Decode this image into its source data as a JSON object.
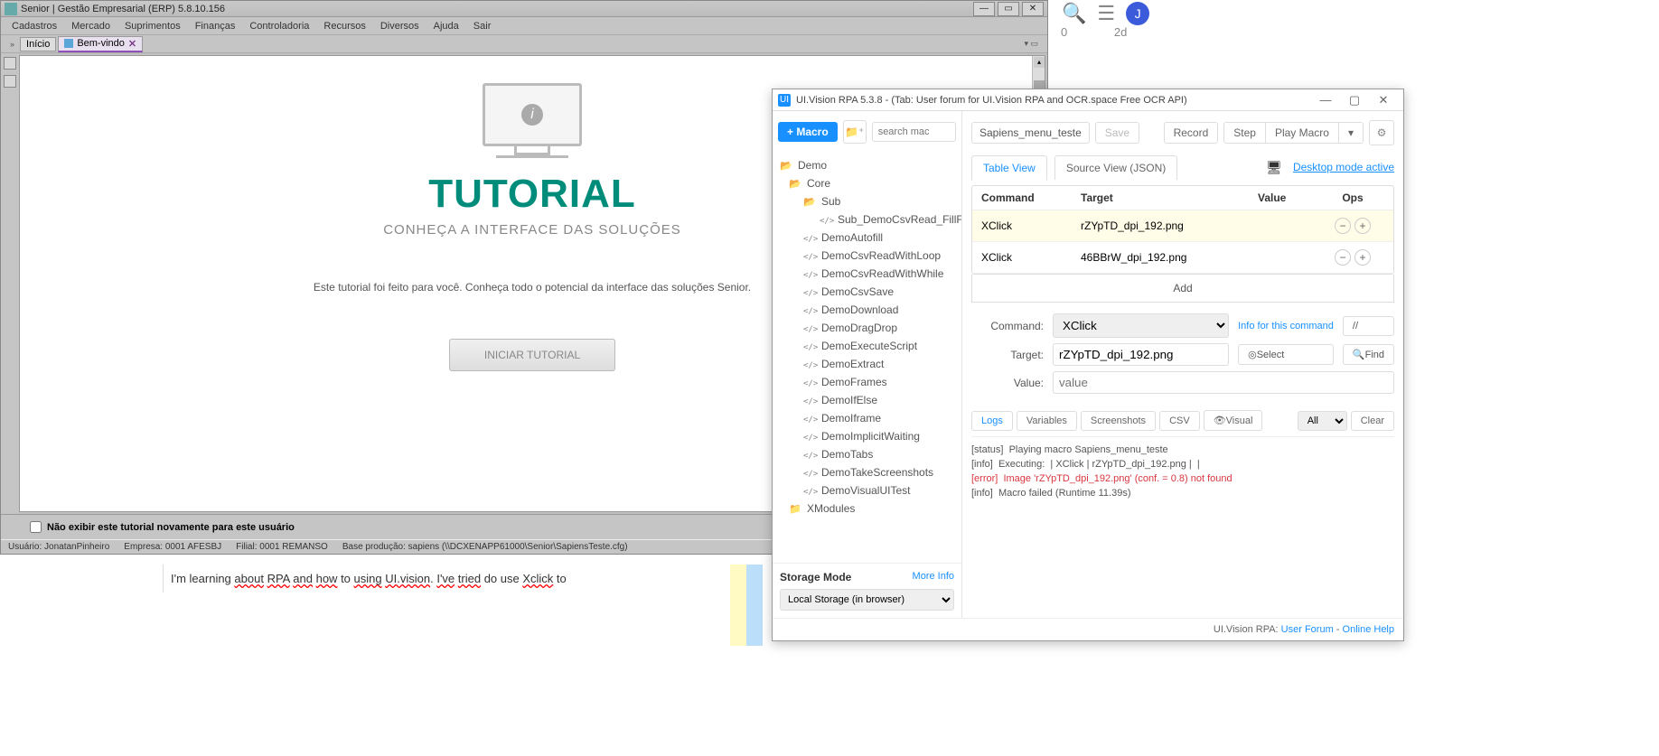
{
  "erp": {
    "title": "Senior | Gestão Empresarial (ERP) 5.8.10.156",
    "menu": [
      "Cadastros",
      "Mercado",
      "Suprimentos",
      "Finanças",
      "Controladoria",
      "Recursos",
      "Diversos",
      "Ajuda",
      "Sair"
    ],
    "tabs": [
      {
        "label": "Início"
      },
      {
        "label": "Bem-vindo",
        "selected": true
      }
    ],
    "tutorial": {
      "heading": "TUTORIAL",
      "sub": "CONHEÇA A INTERFACE DAS SOLUÇÕES",
      "desc": "Este tutorial foi feito para você. Conheça todo o potencial da interface das soluções Senior.",
      "button": "INICIAR TUTORIAL"
    },
    "checkbox": "Não exibir este tutorial novamente para este usuário",
    "status": {
      "user": "Usuário: JonatanPinheiro",
      "empresa": "Empresa: 0001 AFESBJ",
      "filial": "Filial: 0001 REMANSO",
      "base": "Base produção: sapiens (\\\\DCXENAPP61000\\Senior\\SapiensTeste.cfg)"
    }
  },
  "forum_text_pre": "I'm learning ",
  "forum_words": [
    "about",
    " ",
    "RPA",
    " ",
    "and",
    " ",
    "how",
    " to ",
    "using",
    " ",
    "UI.vision",
    ". ",
    "I've",
    " ",
    "tried",
    " do use ",
    "Xclick",
    " to"
  ],
  "rt_bar": {
    "avatar": "J"
  },
  "rt_small": [
    "0",
    "2d"
  ],
  "uivision": {
    "title": "UI.Vision RPA 5.3.8 - (Tab: User forum for UI.Vision RPA and OCR.space Free OCR API)",
    "macro_btn": "+ Macro",
    "search_ph": "search mac",
    "tree": [
      {
        "type": "folder",
        "label": "Demo",
        "depth": 0,
        "open": true
      },
      {
        "type": "folder",
        "label": "Core",
        "depth": 1,
        "open": true
      },
      {
        "type": "folder",
        "label": "Sub",
        "depth": 2,
        "open": true
      },
      {
        "type": "macro",
        "label": "Sub_DemoCsvRead_FillForm",
        "depth": 3
      },
      {
        "type": "macro",
        "label": "DemoAutofill",
        "depth": 2
      },
      {
        "type": "macro",
        "label": "DemoCsvReadWithLoop",
        "depth": 2
      },
      {
        "type": "macro",
        "label": "DemoCsvReadWithWhile",
        "depth": 2
      },
      {
        "type": "macro",
        "label": "DemoCsvSave",
        "depth": 2
      },
      {
        "type": "macro",
        "label": "DemoDownload",
        "depth": 2
      },
      {
        "type": "macro",
        "label": "DemoDragDrop",
        "depth": 2
      },
      {
        "type": "macro",
        "label": "DemoExecuteScript",
        "depth": 2
      },
      {
        "type": "macro",
        "label": "DemoExtract",
        "depth": 2
      },
      {
        "type": "macro",
        "label": "DemoFrames",
        "depth": 2
      },
      {
        "type": "macro",
        "label": "DemoIfElse",
        "depth": 2
      },
      {
        "type": "macro",
        "label": "DemoIframe",
        "depth": 2
      },
      {
        "type": "macro",
        "label": "DemoImplicitWaiting",
        "depth": 2
      },
      {
        "type": "macro",
        "label": "DemoTabs",
        "depth": 2
      },
      {
        "type": "macro",
        "label": "DemoTakeScreenshots",
        "depth": 2
      },
      {
        "type": "macro",
        "label": "DemoVisualUITest",
        "depth": 2
      },
      {
        "type": "folder",
        "label": "XModules",
        "depth": 1,
        "open": false
      }
    ],
    "storage_title": "Storage Mode",
    "storage_more": "More Info",
    "storage_value": "Local Storage (in browser)",
    "macro_name": "Sapiens_menu_teste",
    "btns": {
      "save": "Save",
      "record": "Record",
      "step": "Step",
      "play": "Play Macro"
    },
    "view_tabs": {
      "table": "Table View",
      "source": "Source View (JSON)"
    },
    "desktop_link": "Desktop mode active",
    "cmd_head": [
      "Command",
      "Target",
      "Value",
      "Ops"
    ],
    "rows": [
      {
        "cmd": "XClick",
        "target": "rZYpTD_dpi_192.png",
        "sel": true
      },
      {
        "cmd": "XClick",
        "target": "46BBrW_dpi_192.png"
      }
    ],
    "add": "Add",
    "form": {
      "cmd_label": "Command:",
      "cmd_val": "XClick",
      "cmd_info": "Info for this command",
      "tgt_label": "Target:",
      "tgt_val": "rZYpTD_dpi_192.png",
      "select": "Select",
      "find": "Find",
      "val_label": "Value:",
      "val_ph": "value"
    },
    "log_tabs": [
      "Logs",
      "Variables",
      "Screenshots",
      "CSV",
      "👁Visual"
    ],
    "log_filter": "All",
    "log_clear": "Clear",
    "logs": [
      {
        "t": "[status]",
        "m": "Playing macro Sapiens_menu_teste"
      },
      {
        "t": "[info]",
        "m": "Executing:  | XClick | rZYpTD_dpi_192.png |  |"
      },
      {
        "t": "[error]",
        "m": "Image 'rZYpTD_dpi_192.png' (conf. = 0.8) not found",
        "err": true
      },
      {
        "t": "[info]",
        "m": "Macro failed (Runtime 11.39s)"
      }
    ],
    "footer_pre": "UI.Vision RPA: ",
    "footer_links": [
      "User Forum",
      " - ",
      "Online Help"
    ]
  }
}
